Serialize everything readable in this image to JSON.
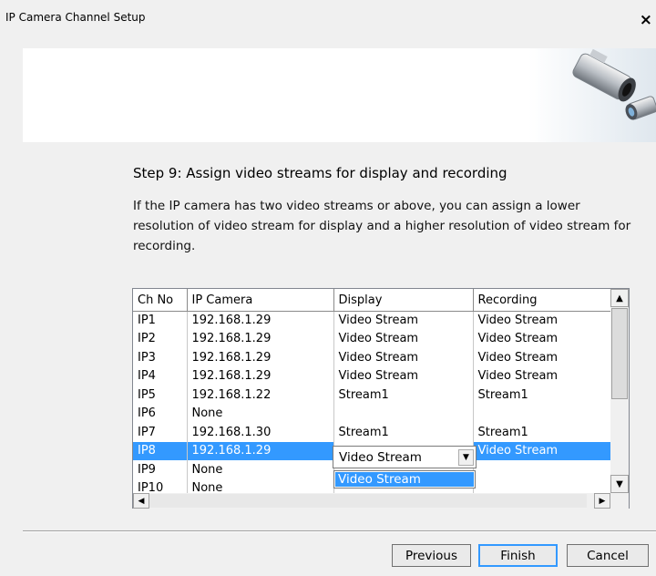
{
  "window": {
    "title": "IP Camera Channel Setup",
    "close_label": "×"
  },
  "step": {
    "heading": "Step 9: Assign video streams for display and recording",
    "description": "If the IP camera has two video streams or above, you can assign a lower resolution of video stream for display and a higher resolution of video stream for recording."
  },
  "grid": {
    "columns": [
      "Ch No",
      "IP Camera",
      "Display",
      "Recording"
    ],
    "rows": [
      [
        "IP1",
        "192.168.1.29",
        "Video Stream",
        "Video Stream"
      ],
      [
        "IP2",
        "192.168.1.29",
        "Video Stream",
        "Video Stream"
      ],
      [
        "IP3",
        "192.168.1.29",
        "Video Stream",
        "Video Stream"
      ],
      [
        "IP4",
        "192.168.1.29",
        "Video Stream",
        "Video Stream"
      ],
      [
        "IP5",
        "192.168.1.22",
        "Stream1",
        "Stream1"
      ],
      [
        "IP6",
        "None",
        "",
        ""
      ],
      [
        "IP7",
        "192.168.1.30",
        "Stream1",
        "Stream1"
      ],
      [
        "IP8",
        "192.168.1.29",
        "",
        "Video Stream"
      ],
      [
        "IP9",
        "None",
        "",
        ""
      ],
      [
        "IP10",
        "None",
        "",
        ""
      ]
    ],
    "selected_row": 7
  },
  "combo": {
    "value": "Video Stream",
    "options": [
      "Video Stream"
    ]
  },
  "buttons": {
    "previous": "Previous",
    "finish": "Finish",
    "cancel": "Cancel"
  },
  "colors": {
    "selection": "#3399ff",
    "background": "#f0f0f0"
  }
}
